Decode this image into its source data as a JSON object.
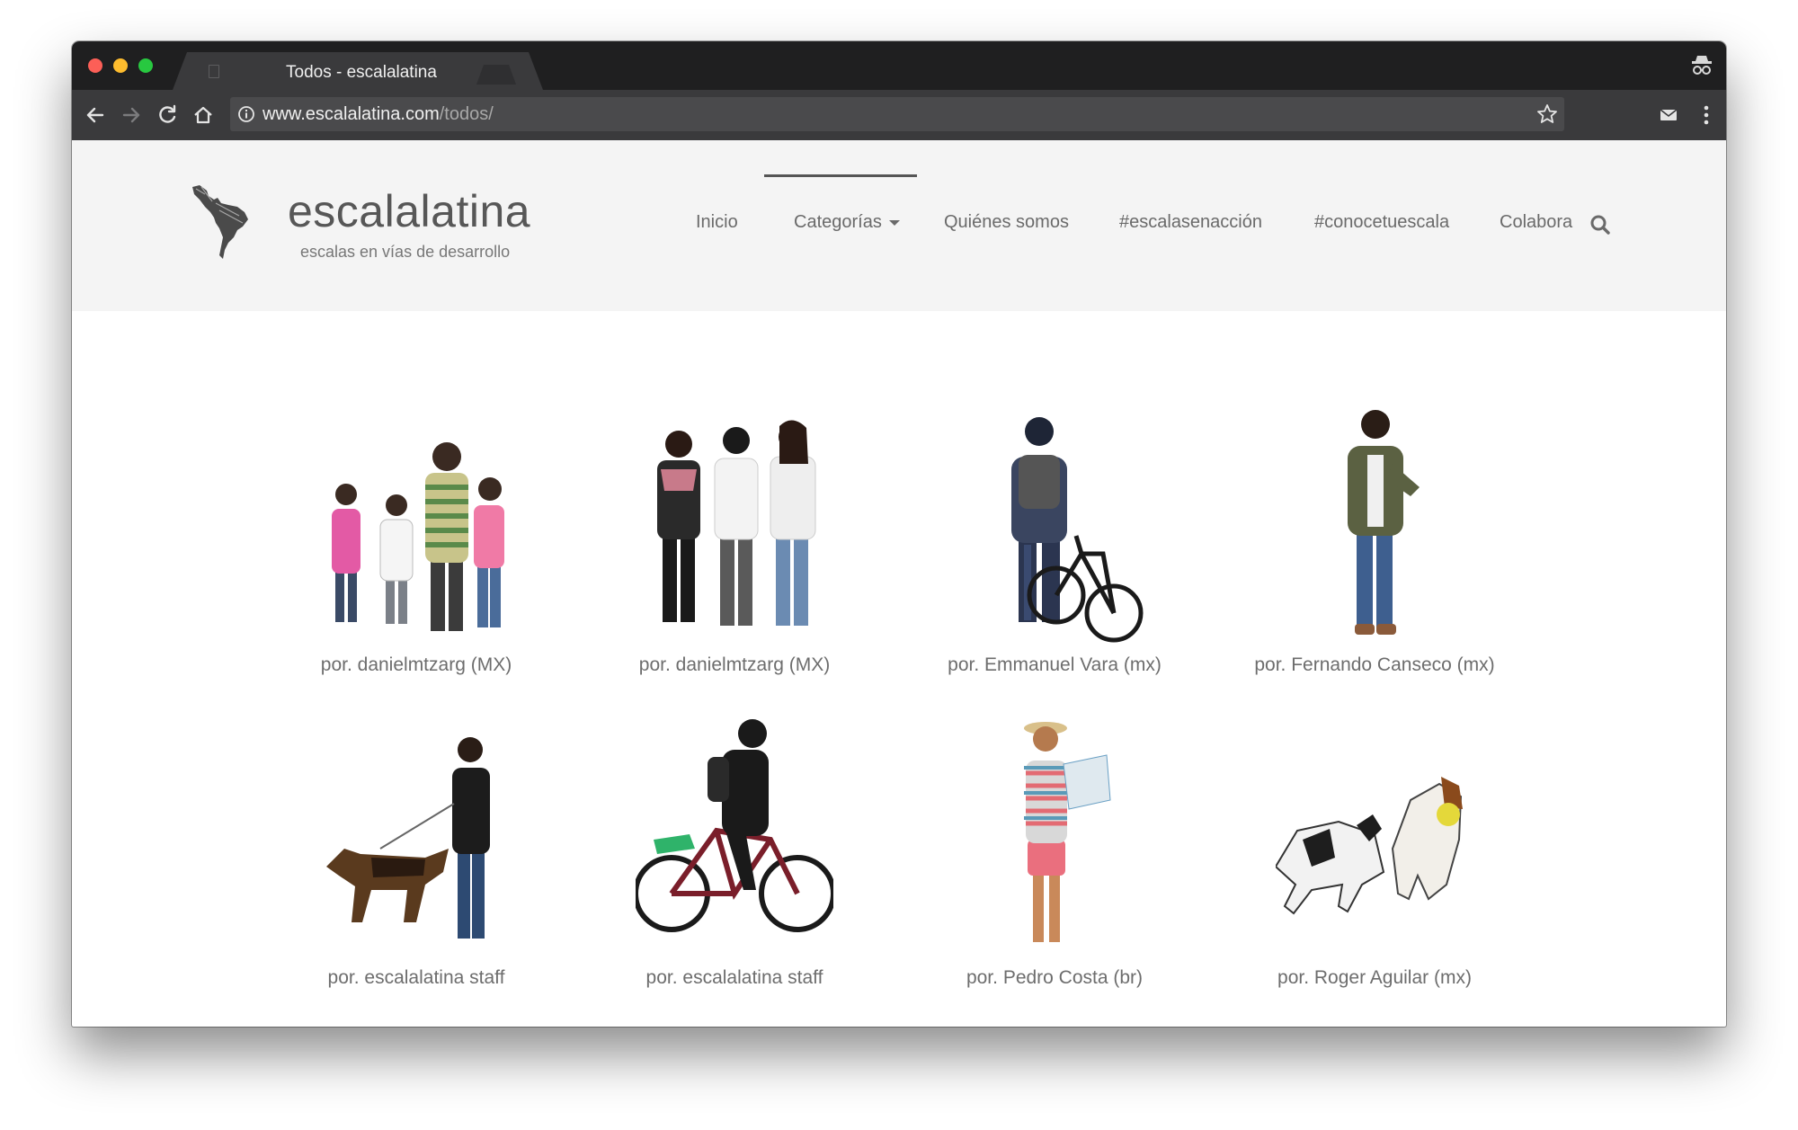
{
  "browser": {
    "tab_title": "Todos - escalalatina",
    "tab_close": "×",
    "url_host": "www.escalalatina.com",
    "url_path": "/todos/"
  },
  "site": {
    "title": "escalalatina",
    "tagline": "escalas en vías de desarrollo",
    "nav": [
      {
        "label": "Inicio"
      },
      {
        "label": "Categorías"
      },
      {
        "label": "Quiénes somos"
      },
      {
        "label": "#escalasenacción"
      },
      {
        "label": "#conocetuescala"
      },
      {
        "label": "Colabora"
      }
    ]
  },
  "items": [
    {
      "caption": "por. danielmtzarg (MX)",
      "image": "family-walking"
    },
    {
      "caption": "por. danielmtzarg (MX)",
      "image": "three-friends-walking"
    },
    {
      "caption": "por. Emmanuel Vara (mx)",
      "image": "man-with-bicycle"
    },
    {
      "caption": "por. Fernando Canseco (mx)",
      "image": "man-checking-watch"
    },
    {
      "caption": "por. escalalatina staff",
      "image": "man-walking-dog"
    },
    {
      "caption": "por. escalalatina staff",
      "image": "man-riding-bicycle"
    },
    {
      "caption": "por. Pedro Costa (br)",
      "image": "man-reading-map"
    },
    {
      "caption": "por. Roger Aguilar (mx)",
      "image": "two-dogs-running"
    }
  ],
  "colors": {
    "browser_frame": "#1f1f20",
    "toolbar": "#3a3a3c",
    "header_bg": "#f4f4f4",
    "text_gray": "#6d6d6d"
  }
}
